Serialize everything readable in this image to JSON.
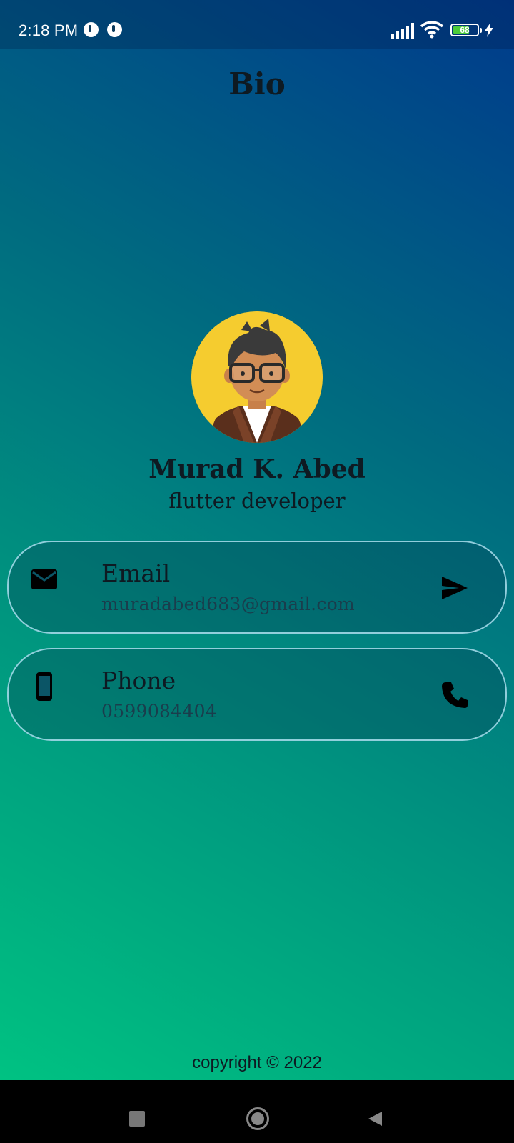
{
  "status_bar": {
    "time": "2:18 PM",
    "battery_level": "68",
    "battery_fraction": 0.68,
    "icons": [
      "notification-app-icon",
      "notification-app-icon",
      "signal-icon",
      "wifi-icon",
      "battery-icon",
      "charging-icon"
    ]
  },
  "header": {
    "title": "Bio"
  },
  "profile": {
    "avatar_icon": "cartoon-avatar-icon",
    "name": "Murad K. Abed",
    "role": "flutter developer"
  },
  "contacts": [
    {
      "title": "Email",
      "value": "muradabed683@gmail.com",
      "icon": "mail-icon",
      "action_icon": "send-icon"
    },
    {
      "title": "Phone",
      "value": "0599084404",
      "icon": "smartphone-icon",
      "action_icon": "phone-call-icon"
    }
  ],
  "footer": {
    "copyright": "copyright © 2022"
  },
  "nav_bar": {
    "buttons": [
      "recents-button",
      "home-button",
      "back-button"
    ]
  },
  "colors": {
    "gradient_bottom_left": "#00c882",
    "gradient_top_right": "#003a8c",
    "text_dark": "#0e1a22",
    "card_border": "#aae1f0",
    "avatar_bg": "#f5cc2f"
  }
}
